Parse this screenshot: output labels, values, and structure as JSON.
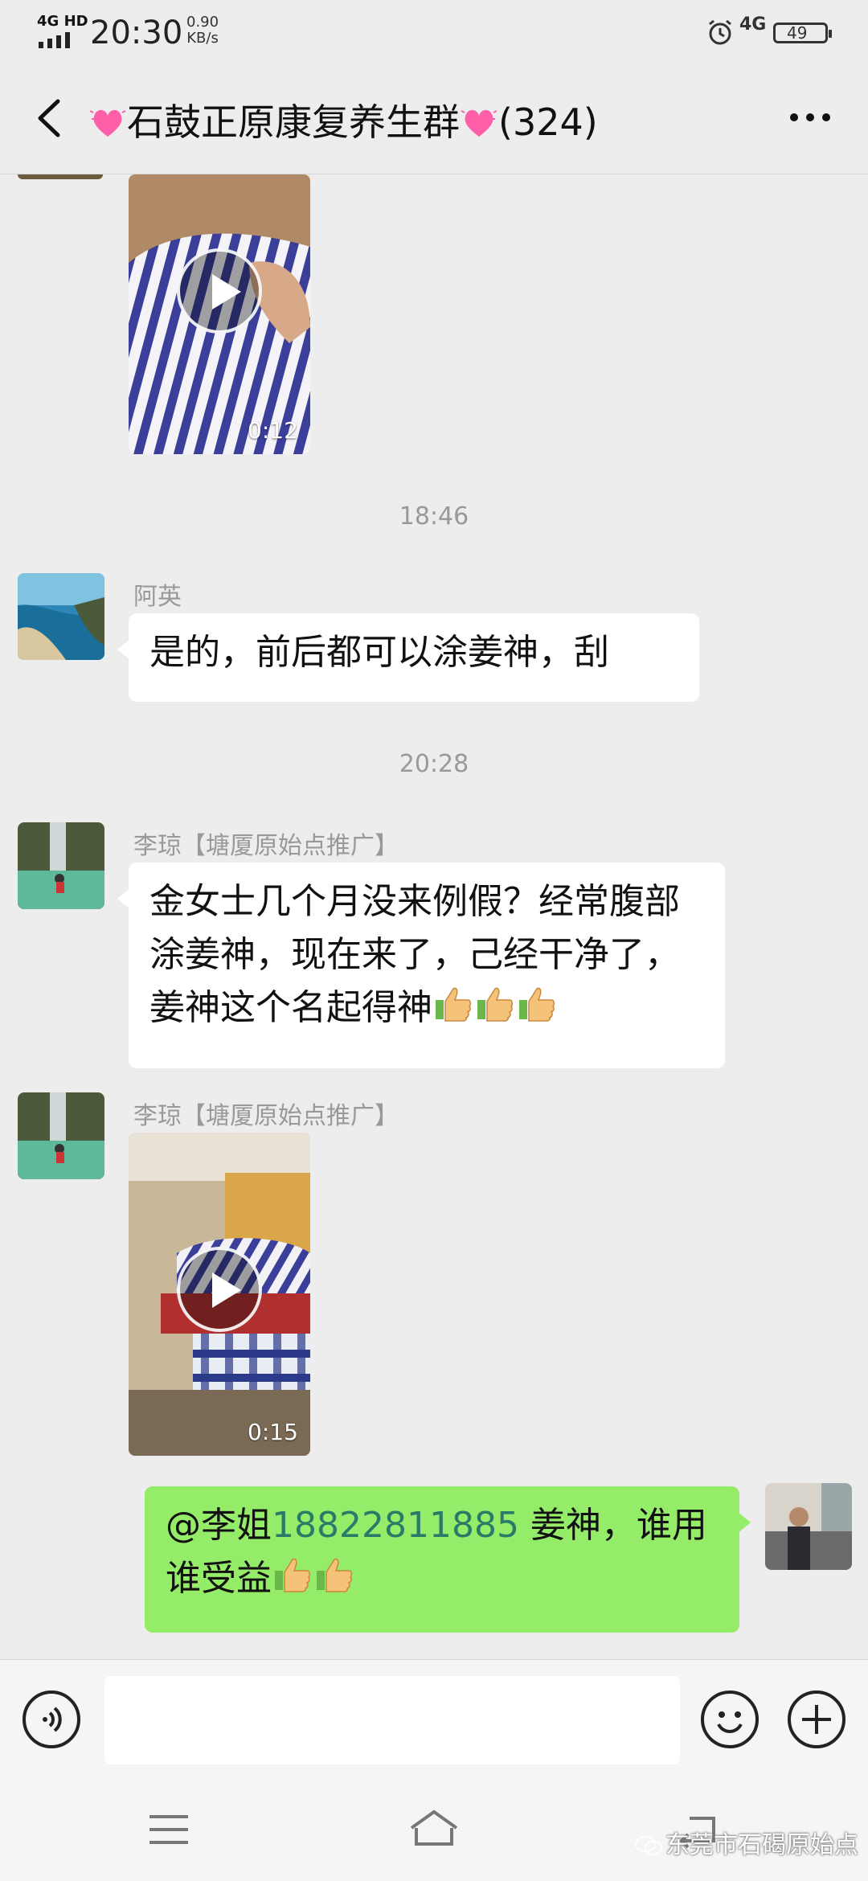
{
  "status_bar": {
    "network": "4G HD",
    "time": "20:30",
    "speed_value": "0.90",
    "speed_unit": "KB/s",
    "network_right": "4G",
    "battery": "49"
  },
  "nav": {
    "title_text": "石鼓正原康复养生群",
    "member_count": "(324)"
  },
  "messages": {
    "video1_duration": "0:12",
    "time1": "18:46",
    "msg1_sender": "阿英",
    "msg1_text": "是的，前后都可以涂姜神，刮",
    "time2": "20:28",
    "msg2_sender": "李琼【塘厦原始点推广】",
    "msg2_text": "金女士几个月没来例假？经常腹部涂姜神，现在来了，己经干净了，姜神这个名起得神",
    "msg3_sender": "李琼【塘厦原始点推广】",
    "video2_duration": "0:15",
    "msg4_mention": "@李姐",
    "msg4_phone": "18822811885",
    "msg4_text": " 姜神，谁用谁受益"
  },
  "input": {
    "placeholder": ""
  },
  "watermark": {
    "text": "东莞市石碣原始点"
  },
  "colors": {
    "background": "#ededed",
    "bubble_self": "#95ec69",
    "bubble_other": "#ffffff",
    "link": "#2a7a6a"
  },
  "icons": [
    "back-arrow-icon",
    "heart-emoji-icon",
    "more-icon",
    "play-icon",
    "thumbs-up-icon",
    "voice-icon",
    "emoji-icon",
    "plus-icon",
    "menu-icon",
    "home-icon",
    "back-icon",
    "wechat-icon"
  ]
}
